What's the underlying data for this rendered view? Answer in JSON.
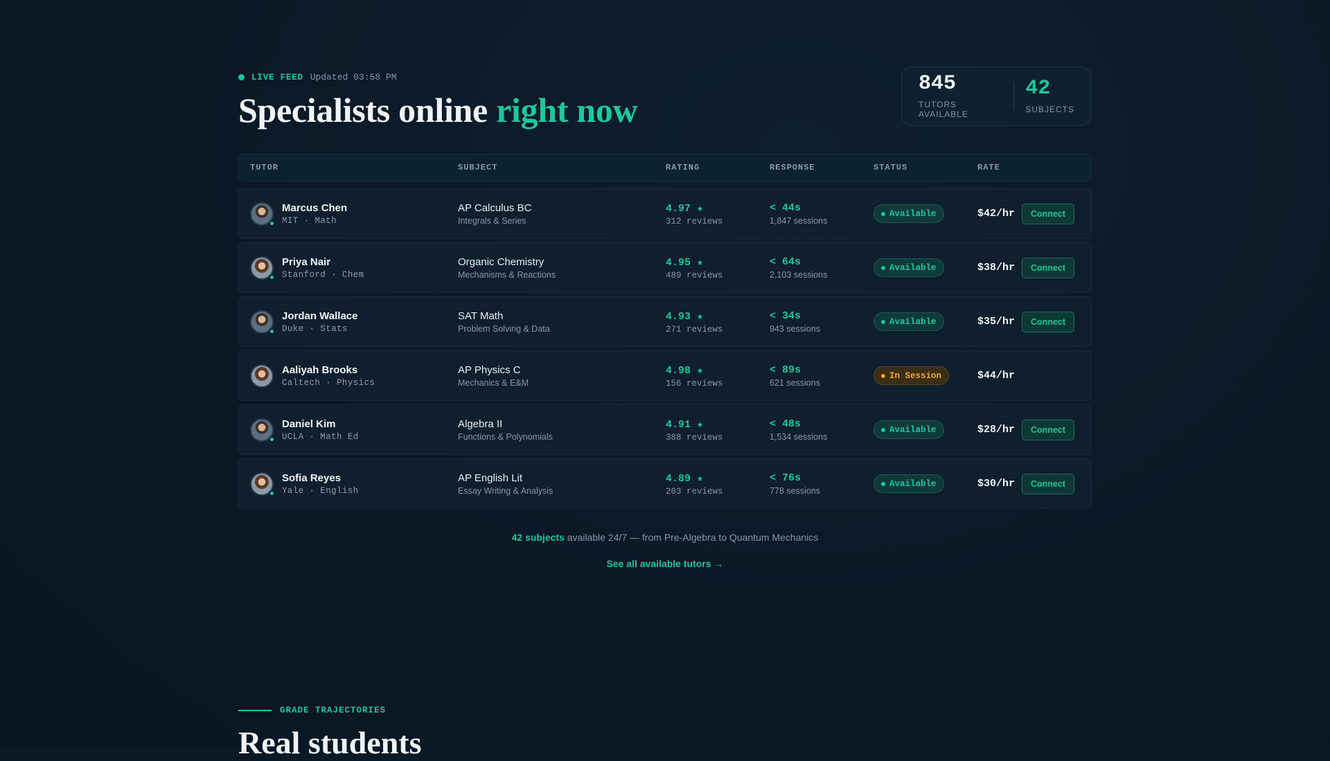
{
  "header": {
    "live_label": "LIVE FEED",
    "updated": "Updated 03:58 PM",
    "headline_main": "Specialists online ",
    "headline_accent": "right now"
  },
  "stats": {
    "tutors_num": "845",
    "tutors_label": "TUTORS AVAILABLE",
    "subjects_num": "42",
    "subjects_label": "SUBJECTS"
  },
  "table": {
    "columns": [
      "TUTOR",
      "SUBJECT",
      "RATING",
      "RESPONSE",
      "STATUS",
      "RATE"
    ],
    "rows": [
      {
        "name": "Marcus Chen",
        "school": "MIT · Math",
        "subject": "AP Calculus BC",
        "topic": "Integrals & Series",
        "rating": "4.97 ★",
        "reviews": "312 reviews",
        "response": "< 44s",
        "sessions": "1,847 sessions",
        "status": "Available",
        "rate": "$42/hr",
        "action": "Connect"
      },
      {
        "name": "Priya Nair",
        "school": "Stanford · Chem",
        "subject": "Organic Chemistry",
        "topic": "Mechanisms & Reactions",
        "rating": "4.95 ★",
        "reviews": "489 reviews",
        "response": "< 64s",
        "sessions": "2,103 sessions",
        "status": "Available",
        "rate": "$38/hr",
        "action": "Connect"
      },
      {
        "name": "Jordan Wallace",
        "school": "Duke · Stats",
        "subject": "SAT Math",
        "topic": "Problem Solving & Data",
        "rating": "4.93 ★",
        "reviews": "271 reviews",
        "response": "< 34s",
        "sessions": "943 sessions",
        "status": "Available",
        "rate": "$35/hr",
        "action": "Connect"
      },
      {
        "name": "Aaliyah Brooks",
        "school": "Caltech · Physics",
        "subject": "AP Physics C",
        "topic": "Mechanics & E&M",
        "rating": "4.98 ★",
        "reviews": "156 reviews",
        "response": "< 89s",
        "sessions": "621 sessions",
        "status": "In Session",
        "rate": "$44/hr",
        "action": ""
      },
      {
        "name": "Daniel Kim",
        "school": "UCLA · Math Ed",
        "subject": "Algebra II",
        "topic": "Functions & Polynomials",
        "rating": "4.91 ★",
        "reviews": "388 reviews",
        "response": "< 48s",
        "sessions": "1,534 sessions",
        "status": "Available",
        "rate": "$28/hr",
        "action": "Connect"
      },
      {
        "name": "Sofia Reyes",
        "school": "Yale · English",
        "subject": "AP English Lit",
        "topic": "Essay Writing & Analysis",
        "rating": "4.89 ★",
        "reviews": "203 reviews",
        "response": "< 76s",
        "sessions": "778 sessions",
        "status": "Available",
        "rate": "$30/hr",
        "action": "Connect"
      }
    ]
  },
  "footer": {
    "subjects_em": "42 subjects",
    "subjects_rest": " available 24/7 — from Pre-Algebra to Quantum Mechanics",
    "see_all": "See all available tutors →"
  },
  "next_section": {
    "label": "GRADE TRAJECTORIES",
    "title": "Real students"
  },
  "colors": {
    "accent": "#1fc79b",
    "busy": "#f0a72c",
    "background": "#0b1826"
  }
}
